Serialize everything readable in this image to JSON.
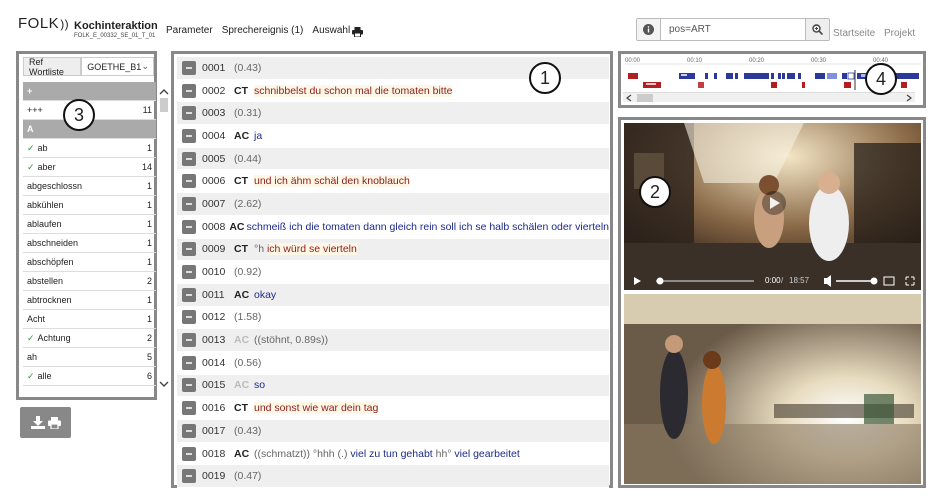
{
  "header": {
    "logo": "FOLK",
    "title": "Kochinteraktion",
    "subtitle": "FOLK_E_00332_SE_01_T_01",
    "nav": [
      "Parameter",
      "Sprechereignis (1)",
      "Auswahl"
    ],
    "search_value": "pos=ART",
    "links": [
      "Startseite",
      "Projekt"
    ]
  },
  "badges": [
    "1",
    "2",
    "3",
    "4"
  ],
  "wordlist": {
    "ref_label": "Ref Wortliste",
    "selected": "GOETHE_B1",
    "rows": [
      {
        "word": "+",
        "count": "",
        "header": true
      },
      {
        "word": "+++",
        "count": "11"
      },
      {
        "word": "A",
        "count": "",
        "header": true
      },
      {
        "word": "ab",
        "count": "1",
        "check": true
      },
      {
        "word": "aber",
        "count": "14",
        "check": true
      },
      {
        "word": "abgeschlossn",
        "count": "1"
      },
      {
        "word": "abkühlen",
        "count": "1"
      },
      {
        "word": "ablaufen",
        "count": "1"
      },
      {
        "word": "abschneiden",
        "count": "1"
      },
      {
        "word": "abschöpfen",
        "count": "1"
      },
      {
        "word": "abstellen",
        "count": "2"
      },
      {
        "word": "abtrocknen",
        "count": "1"
      },
      {
        "word": "Acht",
        "count": "1"
      },
      {
        "word": "Achtung",
        "count": "2",
        "check": true
      },
      {
        "word": "ah",
        "count": "5"
      },
      {
        "word": "alle",
        "count": "6",
        "check": true
      }
    ]
  },
  "transcript": [
    {
      "num": "0001",
      "pause": "(0.43)"
    },
    {
      "num": "0002",
      "spk": "CT",
      "parts": [
        {
          "t": "schnibbelst du schon mal die tomaten bitte",
          "c": "ct"
        }
      ]
    },
    {
      "num": "0003",
      "pause": "(0.31)"
    },
    {
      "num": "0004",
      "spk": "AC",
      "parts": [
        {
          "t": "ja",
          "c": "ac"
        }
      ]
    },
    {
      "num": "0005",
      "pause": "(0.44)"
    },
    {
      "num": "0006",
      "spk": "CT",
      "parts": [
        {
          "t": "und ich ähm schäl den knoblauch",
          "c": "ct"
        }
      ]
    },
    {
      "num": "0007",
      "pause": "(2.62)"
    },
    {
      "num": "0008",
      "spk": "AC",
      "parts": [
        {
          "t": "schmeiß ich die tomaten dann gleich rein soll ich se halb schälen oder vierteln",
          "c": "ac"
        }
      ]
    },
    {
      "num": "0009",
      "spk": "CT",
      "parts": [
        {
          "t": "°h ",
          "c": "grey"
        },
        {
          "t": "ich würd se vierteln",
          "c": "ct"
        }
      ]
    },
    {
      "num": "0010",
      "pause": "(0.92)"
    },
    {
      "num": "0011",
      "spk": "AC",
      "parts": [
        {
          "t": "okay",
          "c": "ac"
        }
      ]
    },
    {
      "num": "0012",
      "pause": "(1.58)"
    },
    {
      "num": "0013",
      "spk": "AC",
      "dim": true,
      "parts": [
        {
          "t": "((stöhnt, 0.89s))",
          "c": "grey"
        }
      ]
    },
    {
      "num": "0014",
      "pause": "(0.56)"
    },
    {
      "num": "0015",
      "spk": "AC",
      "dim": true,
      "parts": [
        {
          "t": "so",
          "c": "ac"
        }
      ]
    },
    {
      "num": "0016",
      "spk": "CT",
      "parts": [
        {
          "t": "und sonst wie war dein tag",
          "c": "ct"
        }
      ]
    },
    {
      "num": "0017",
      "pause": "(0.43)"
    },
    {
      "num": "0018",
      "spk": "AC",
      "parts": [
        {
          "t": "((schmatzt)) °hhh (.) ",
          "c": "grey"
        },
        {
          "t": "viel zu tun gehabt",
          "c": "ac"
        },
        {
          "t": " hh° ",
          "c": "grey"
        },
        {
          "t": "viel gearbeitet",
          "c": "ac"
        }
      ]
    },
    {
      "num": "0019",
      "pause": "(0.47)"
    }
  ],
  "timeline": {
    "ticks": [
      "00:00",
      "00:10",
      "00:20",
      "00:30",
      "00:40"
    ]
  },
  "video": {
    "time": "0:00",
    "duration": "18:57"
  }
}
